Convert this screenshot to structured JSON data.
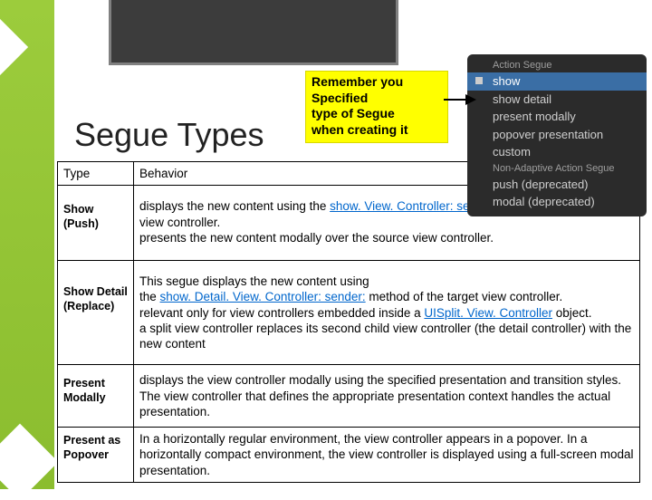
{
  "title": "Segue Types",
  "callout": {
    "line1": "Remember you",
    "line2": "Specified",
    "line3": "type of Segue",
    "line4": "when creating it"
  },
  "segue_menu": {
    "header1": "Action Segue",
    "items1": [
      "show",
      "show detail",
      "present modally",
      "popover presentation",
      "custom"
    ],
    "header2": "Non-Adaptive Action Segue",
    "items2": [
      "push (deprecated)",
      "modal (deprecated)"
    ]
  },
  "table": {
    "head": {
      "c1": "Type",
      "c2": "Behavior"
    },
    "rows": [
      {
        "type": "Show\n(Push)",
        "b1": "displays the new content using the ",
        "l1": "show. View. Controller: sender:",
        "b2": " method of the target view controller.",
        "b3": "presents the new content modally over the source view controller."
      },
      {
        "type": "Show Detail (Replace)",
        "b1": "This segue displays the new content using",
        "b2a": "the ",
        "l1": "show. Detail. View. Controller: sender:",
        "b2b": " method of the target view controller.",
        "b3a": "relevant only for view controllers embedded inside a ",
        "l2": "UISplit. View. Controller",
        "b3b": " object.",
        "b4": "a split view controller replaces its second child view controller (the detail controller) with the new content"
      },
      {
        "type": "Present Modally",
        "b1": "displays the view controller modally using the specified presentation and transition styles. The view controller that defines the appropriate presentation context handles the actual presentation."
      },
      {
        "type": "Present as Popover",
        "b1": "In a horizontally regular environment, the view controller appears in a popover. In a horizontally compact environment, the view controller is displayed using a full-screen modal presentation."
      }
    ]
  }
}
